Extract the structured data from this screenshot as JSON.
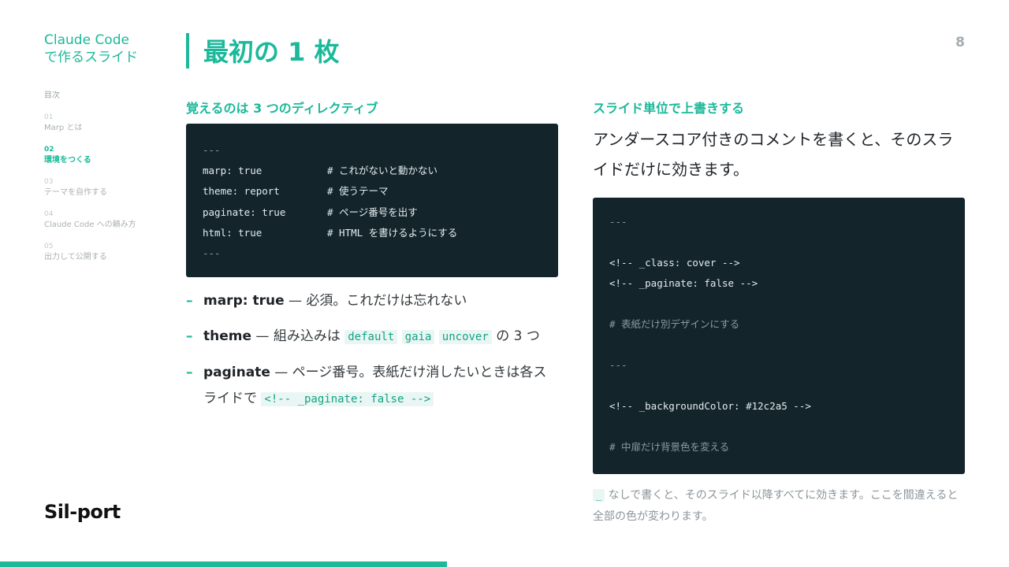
{
  "sidebar": {
    "brand_line1": "Claude Code",
    "brand_line2": "で作るスライド",
    "toc_title": "目次",
    "items": [
      {
        "num": "01",
        "label": "Marp とは",
        "active": false
      },
      {
        "num": "02",
        "label": "環境をつくる",
        "active": true
      },
      {
        "num": "03",
        "label": "テーマを自作する",
        "active": false
      },
      {
        "num": "04",
        "label": "Claude Code への頼み方",
        "active": false
      },
      {
        "num": "05",
        "label": "出力して公開する",
        "active": false
      }
    ],
    "logo": "Sil-port"
  },
  "header": {
    "title": "最初の 1 枚",
    "page_number": "8"
  },
  "progress": 0.443,
  "left": {
    "heading": "覚えるのは 3 つのディレクティブ",
    "code": {
      "open": "---",
      "lines": [
        {
          "key": "marp: true",
          "comment": "# これがないと動かない"
        },
        {
          "key": "theme: report",
          "comment": "# 使うテーマ"
        },
        {
          "key": "paginate: true",
          "comment": "# ページ番号を出す"
        },
        {
          "key": "html: true",
          "comment": "# HTML を書けるようにする"
        }
      ],
      "close": "---"
    },
    "bullets": {
      "b1": {
        "term": "marp: true",
        "text": " — 必須。これだけは忘れない"
      },
      "b2": {
        "term": "theme",
        "text": " — 組み込みは ",
        "codes": [
          "default",
          "gaia",
          "uncover"
        ],
        "tail": " の 3 つ"
      },
      "b3": {
        "term": "paginate",
        "text": " — ページ番号。表紙だけ消したいときは各スライドで ",
        "code": "<!-- _paginate: false -->"
      }
    }
  },
  "right": {
    "heading": "スライド単位で上書きする",
    "lead": "アンダースコア付きのコメントを書くと、そのスライドだけに効きます。",
    "code": {
      "l1": "---",
      "l2": "<!-- _class: cover -->",
      "l3": "<!-- _paginate: false -->",
      "l4": "# 表紙だけ別デザインにする",
      "l5": "---",
      "l6": "<!-- _backgroundColor: #12c2a5 -->",
      "l7": "# 中扉だけ背景色を変える"
    },
    "note_code": "_",
    "note_text": " なしで書くと、そのスライド以降すべてに効きます。ここを間違えると全部の色が変わります。"
  }
}
